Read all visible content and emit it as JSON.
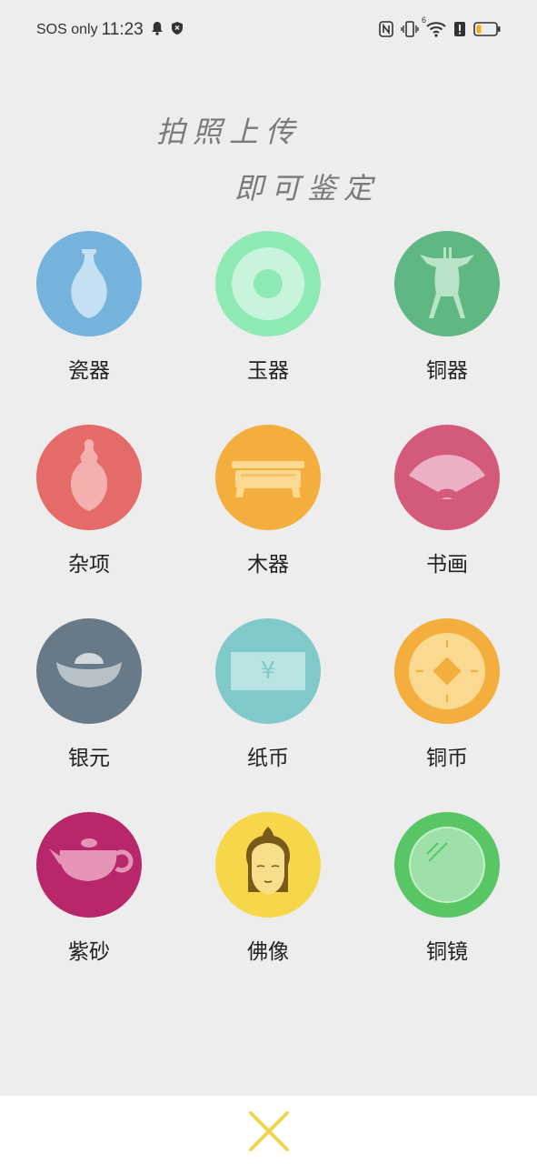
{
  "status_bar": {
    "carrier": "SOS only",
    "time": "11:23",
    "icons": [
      "bell-icon",
      "shield-icon",
      "nfc-icon",
      "vibrate-icon",
      "wifi-icon",
      "alert-icon",
      "battery-icon"
    ],
    "wifi_badge": "6"
  },
  "slogan": {
    "line1": "拍照上传",
    "line2": "即可鉴定"
  },
  "categories": [
    {
      "label": "瓷器",
      "icon": "vase-icon",
      "color": "#76b3dc"
    },
    {
      "label": "玉器",
      "icon": "jade-disc-icon",
      "color": "#8eeab4"
    },
    {
      "label": "铜器",
      "icon": "bronze-vessel-icon",
      "color": "#5fb783"
    },
    {
      "label": "杂项",
      "icon": "gourd-bottle-icon",
      "color": "#e46b67"
    },
    {
      "label": "木器",
      "icon": "wood-table-icon",
      "color": "#f4ae3d"
    },
    {
      "label": "书画",
      "icon": "folding-fan-icon",
      "color": "#d45a7c"
    },
    {
      "label": "银元",
      "icon": "silver-ingot-icon",
      "color": "#687a87"
    },
    {
      "label": "纸币",
      "icon": "banknote-icon",
      "color": "#80c9c9"
    },
    {
      "label": "铜币",
      "icon": "copper-coin-icon",
      "color": "#f4ae3d"
    },
    {
      "label": "紫砂",
      "icon": "teapot-icon",
      "color": "#b8276a"
    },
    {
      "label": "佛像",
      "icon": "buddha-icon",
      "color": "#f7d74a"
    },
    {
      "label": "铜镜",
      "icon": "bronze-mirror-icon",
      "color": "#58c665"
    }
  ],
  "banknote_symbol": "¥",
  "bottom_bar": {
    "close_icon": "close-icon",
    "close_color": "#f0d34a"
  }
}
